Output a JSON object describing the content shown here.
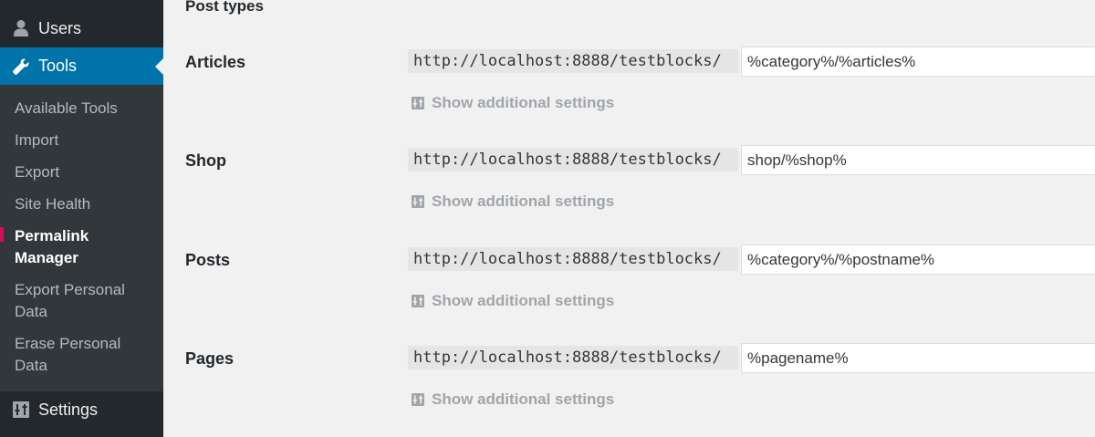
{
  "sidebar": {
    "users_label": "Users",
    "tools_label": "Tools",
    "settings_label": "Settings",
    "submenu": [
      "Available Tools",
      "Import",
      "Export",
      "Site Health",
      "Permalink Manager",
      "Export Personal Data",
      "Erase Personal Data"
    ],
    "current_item": "Permalink Manager"
  },
  "main": {
    "section_title": "Post types",
    "base_url": "http://localhost:8888/testblocks/",
    "toggle_label": "Show additional settings",
    "rows": [
      {
        "label": "Articles",
        "value": "%category%/%articles%"
      },
      {
        "label": "Shop",
        "value": "shop/%shop%"
      },
      {
        "label": "Posts",
        "value": "%category%/%postname%"
      },
      {
        "label": "Pages",
        "value": "%pagename%"
      }
    ]
  },
  "colors": {
    "sidebar_bg": "#23282d",
    "submenu_bg": "#32373c",
    "active_bg": "#0073aa",
    "page_bg": "#f1f1f1"
  },
  "icons": {
    "users": "user-icon",
    "tools": "wrench-icon",
    "settings": "sliders-icon",
    "toggle": "settings-toggle-icon"
  }
}
